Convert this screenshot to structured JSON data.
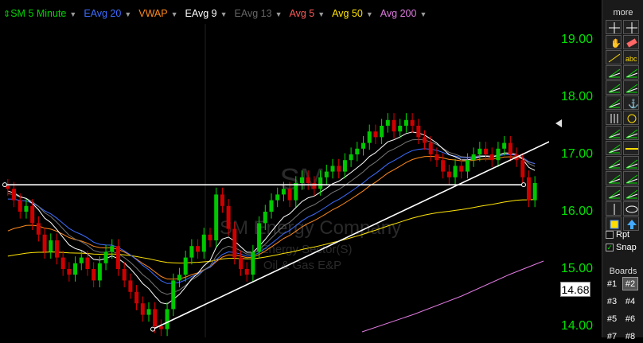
{
  "legend": {
    "items": [
      {
        "label": "SM 5 Minute",
        "color": "#00d200"
      },
      {
        "label": "EAvg 20",
        "color": "#3c6dff"
      },
      {
        "label": "VWAP",
        "color": "#ff8a1a"
      },
      {
        "label": "EAvg 9",
        "color": "#ffffff"
      },
      {
        "label": "EAvg 13",
        "color": "#666666"
      },
      {
        "label": "Avg 5",
        "color": "#ff5a5a"
      },
      {
        "label": "Avg 50",
        "color": "#ffe400"
      },
      {
        "label": "Avg 200",
        "color": "#e07ae0"
      }
    ]
  },
  "watermark": {
    "symbol": "SM",
    "company": "SM Energy Company",
    "sector": "Energy Sector(S)",
    "industry": "Oil & Gas E&P"
  },
  "price_axis": {
    "labels": [
      "19.00",
      "18.00",
      "17.00",
      "16.00",
      "15.00",
      "14.00"
    ],
    "current_price": "14.68"
  },
  "toolbar": {
    "more_label": "more",
    "tools": [
      "crosshair-icon",
      "pan-icon",
      "hand-icon",
      "eraser-icon",
      "trendline-icon",
      "text-abc-icon",
      "fan-icon",
      "multi-fan-icon",
      "arc-icon",
      "grid-fan-icon",
      "fib-icon",
      "anchor-icon",
      "bars-icon",
      "clock-icon",
      "pitchfork-icon",
      "multi-line-icon",
      "channel-icon",
      "hline-icon",
      "chart-icon",
      "parallel-lines-icon",
      "bracket-icon",
      "parallel-icon",
      "stack-icon",
      "fan-lines-icon",
      "range-icon",
      "ellipse-icon",
      "square-icon",
      "up-arrow-icon"
    ],
    "rpt_label": "Rpt",
    "snap_label": "Snap",
    "boards_label": "Boards",
    "boards": [
      "#1",
      "#2",
      "#3",
      "#4",
      "#5",
      "#6",
      "#7",
      "#8"
    ]
  },
  "chart_data": {
    "type": "candlestick",
    "symbol": "SM",
    "interval": "5 Minute",
    "ylim": [
      13.85,
      19.55
    ],
    "yticks": [
      19.0,
      18.0,
      17.0,
      16.0,
      15.0,
      14.0
    ],
    "grid": false,
    "close_series": [
      16.4,
      16.2,
      16.0,
      16.1,
      15.8,
      15.6,
      15.3,
      15.5,
      15.2,
      15.0,
      14.9,
      15.1,
      15.2,
      15.0,
      14.8,
      15.1,
      15.3,
      15.4,
      15.0,
      14.8,
      14.6,
      14.4,
      14.2,
      14.3,
      14.0,
      13.95,
      14.3,
      14.8,
      14.9,
      15.2,
      15.4,
      15.3,
      15.6,
      15.5,
      16.3,
      16.1,
      15.7,
      15.2,
      15.0,
      14.9,
      15.3,
      15.8,
      16.0,
      16.2,
      16.3,
      16.4,
      16.2,
      16.5,
      16.6,
      16.5,
      16.4,
      16.6,
      16.7,
      16.8,
      16.7,
      16.9,
      17.0,
      17.1,
      17.2,
      17.4,
      17.3,
      17.5,
      17.6,
      17.4,
      17.5,
      17.6,
      17.5,
      17.3,
      17.2,
      17.0,
      16.9,
      16.7,
      16.6,
      16.8,
      16.7,
      16.9,
      17.0,
      17.1,
      17.0,
      16.9,
      17.1,
      17.2,
      17.0,
      16.9,
      16.6,
      16.2,
      16.5
    ],
    "drawn_lines": [
      {
        "type": "horizontal",
        "y": 16.47
      },
      {
        "type": "trend",
        "from": [
          0.28,
          13.95
        ],
        "to": [
          1.0,
          17.27
        ]
      },
      {
        "type": "horizontal_segment",
        "y": 16.47,
        "from_x": 0.78,
        "to_x": 0.955
      }
    ]
  }
}
